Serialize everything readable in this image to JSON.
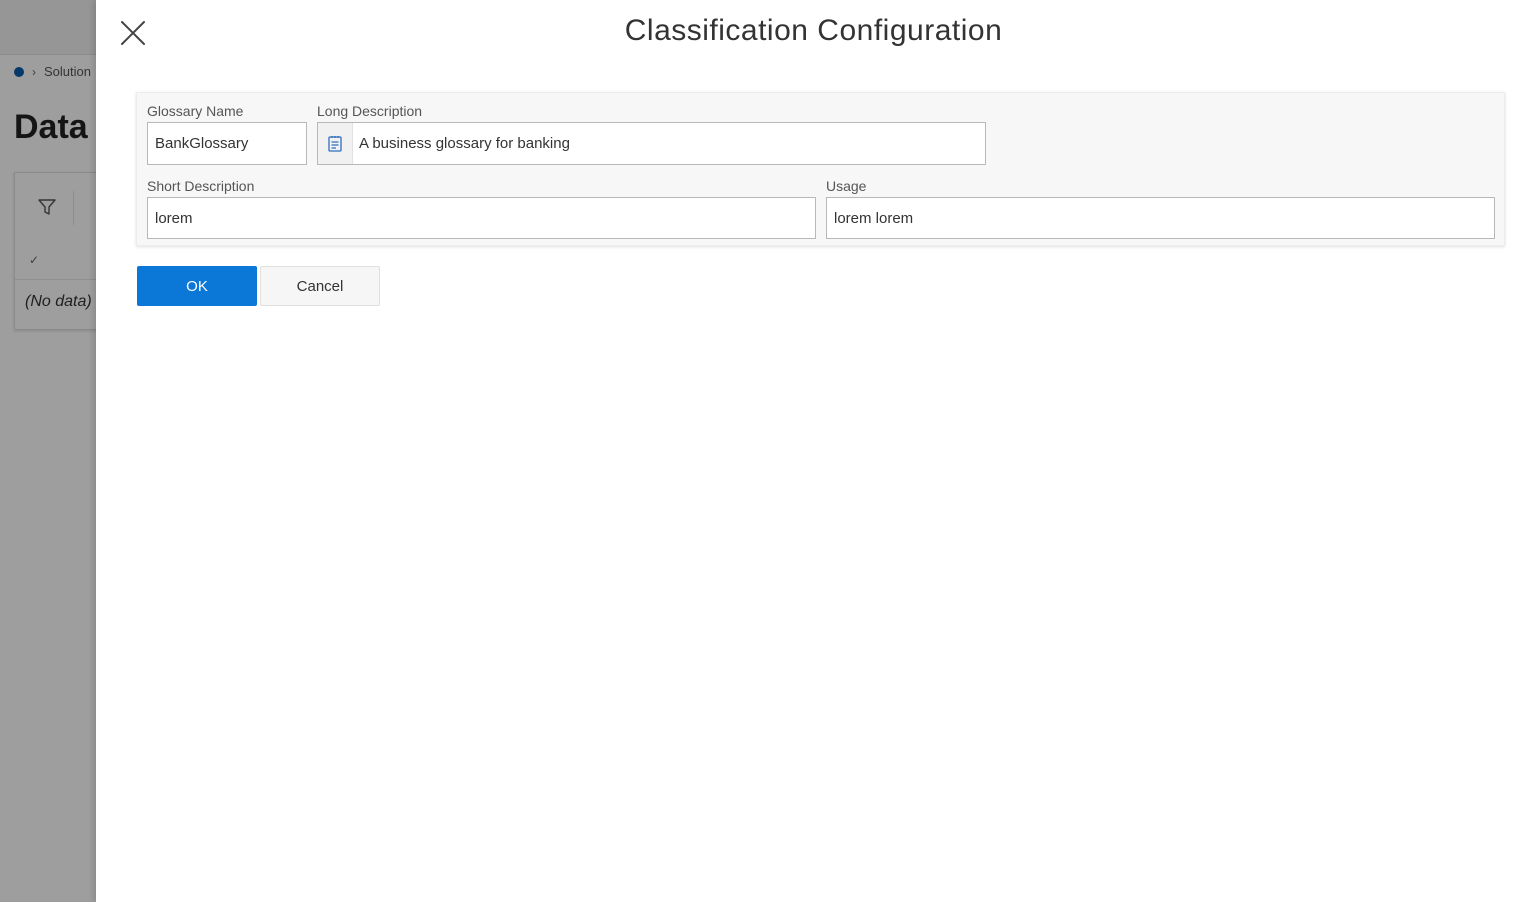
{
  "background": {
    "breadcrumb": "Solution",
    "page_title": "Data",
    "no_data": "(No data)"
  },
  "panel": {
    "title": "Classification Configuration",
    "fields": {
      "glossary_name": {
        "label": "Glossary Name",
        "value": "BankGlossary"
      },
      "long_description": {
        "label": "Long Description",
        "value": "A business glossary for banking"
      },
      "short_description": {
        "label": "Short Description",
        "value": "lorem"
      },
      "usage": {
        "label": "Usage",
        "value": "lorem lorem"
      }
    },
    "buttons": {
      "ok": "OK",
      "cancel": "Cancel"
    }
  },
  "icons": {
    "close": "close-icon",
    "notepad": "notepad-icon",
    "filter": "filter-icon",
    "refresh": "refresh-icon"
  },
  "colors": {
    "primary": "#0b78d7",
    "breadcrumb_dot": "#0b5cad"
  }
}
